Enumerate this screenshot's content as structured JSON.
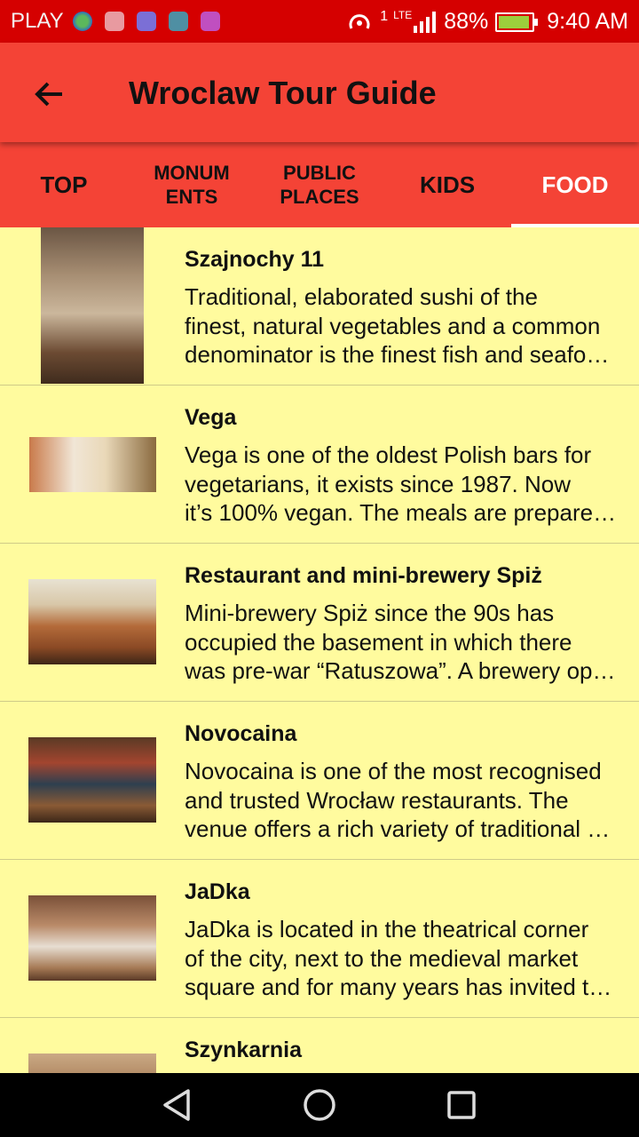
{
  "status": {
    "carrier": "PLAY",
    "network": "1",
    "network_type": "LTE",
    "battery": "88%",
    "time": "9:40 AM",
    "notification_icons": [
      "globe-icon",
      "mail-icon",
      "sync-app-icon",
      "android-app-icon",
      "gallery-icon"
    ]
  },
  "appbar": {
    "title": "Wroclaw Tour Guide",
    "back_icon": "arrow-back-icon"
  },
  "tabs": [
    {
      "label": "TOP",
      "lines": [
        "TOP"
      ],
      "active": false
    },
    {
      "label": "MONUMENTS",
      "lines": [
        "MONUM",
        "ENTS"
      ],
      "active": false
    },
    {
      "label": "PUBLIC PLACES",
      "lines": [
        "PUBLIC",
        "PLACES"
      ],
      "active": false
    },
    {
      "label": "KIDS",
      "lines": [
        "KIDS"
      ],
      "active": false
    },
    {
      "label": "FOOD",
      "lines": [
        "FOOD"
      ],
      "active": true
    }
  ],
  "items": [
    {
      "title": "Szajnochy 11",
      "lines": [
        "Traditional, elaborated sushi of the",
        "finest, natural vegetables and a common",
        "denominator is the finest fish and seafo…"
      ],
      "thumb": "portrait"
    },
    {
      "title": "Vega",
      "lines": [
        "Vega is one of the oldest Polish bars for",
        "vegetarians, it exists since 1987. Now",
        "it’s 100% vegan. The meals are prepare…"
      ],
      "thumb": "wide"
    },
    {
      "title": "Restaurant and mini-brewery Spiż",
      "lines": [
        "Mini-brewery Spiż since the 90s has",
        "occupied the basement in which there",
        "was pre-war “Ratuszowa”. A brewery op…"
      ],
      "thumb": "wide"
    },
    {
      "title": "Novocaina",
      "lines": [
        "Novocaina is one of the most recognised",
        "and trusted Wrocław restaurants. The",
        "venue offers a rich variety of traditional …"
      ],
      "thumb": "wide"
    },
    {
      "title": "JaDka",
      "lines": [
        "JaDka is located in the theatrical corner",
        "of the city, next to the medieval market",
        "square and for many years has invited t…"
      ],
      "thumb": "wide"
    },
    {
      "title": "Szynkarnia",
      "lines": [],
      "thumb": "wide"
    }
  ],
  "colors": {
    "status_bar": "#D50000",
    "app_bar": "#F44336",
    "list_bg": "#FFFB9E",
    "nav_bar": "#000000"
  },
  "navbar": {
    "icons": [
      "back-triangle-icon",
      "home-circle-icon",
      "recents-square-icon"
    ]
  }
}
